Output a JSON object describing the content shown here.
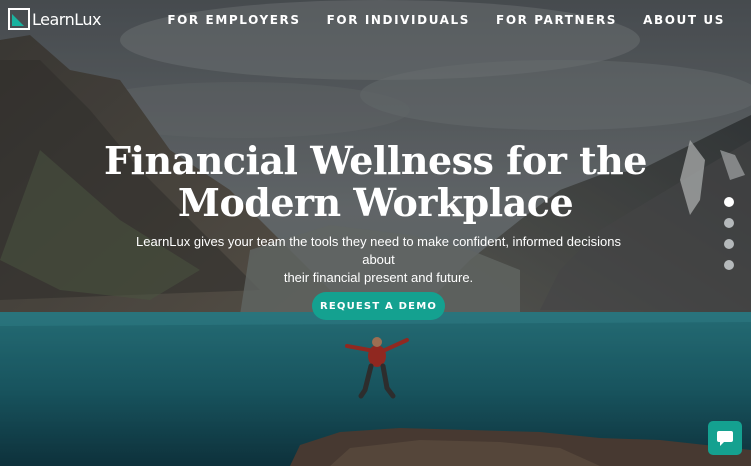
{
  "brand": {
    "name": "LearnLux",
    "accent_color": "#14a190"
  },
  "nav": {
    "items": [
      {
        "label": "FOR EMPLOYERS"
      },
      {
        "label": "FOR INDIVIDUALS"
      },
      {
        "label": "FOR PARTNERS"
      },
      {
        "label": "ABOUT US"
      }
    ]
  },
  "hero": {
    "headline_line1": "Financial Wellness for the",
    "headline_line2": "Modern Workplace",
    "subtitle_line1": "LearnLux gives your team the tools they need to make confident, informed decisions about",
    "subtitle_line2": "their financial present and future.",
    "cta_label": "REQUEST A DEMO",
    "background_image": "mountain-lake-jumping-person"
  },
  "carousel": {
    "slide_count": 4,
    "active_index": 0
  },
  "chat": {
    "icon": "chat-bubble-icon"
  }
}
